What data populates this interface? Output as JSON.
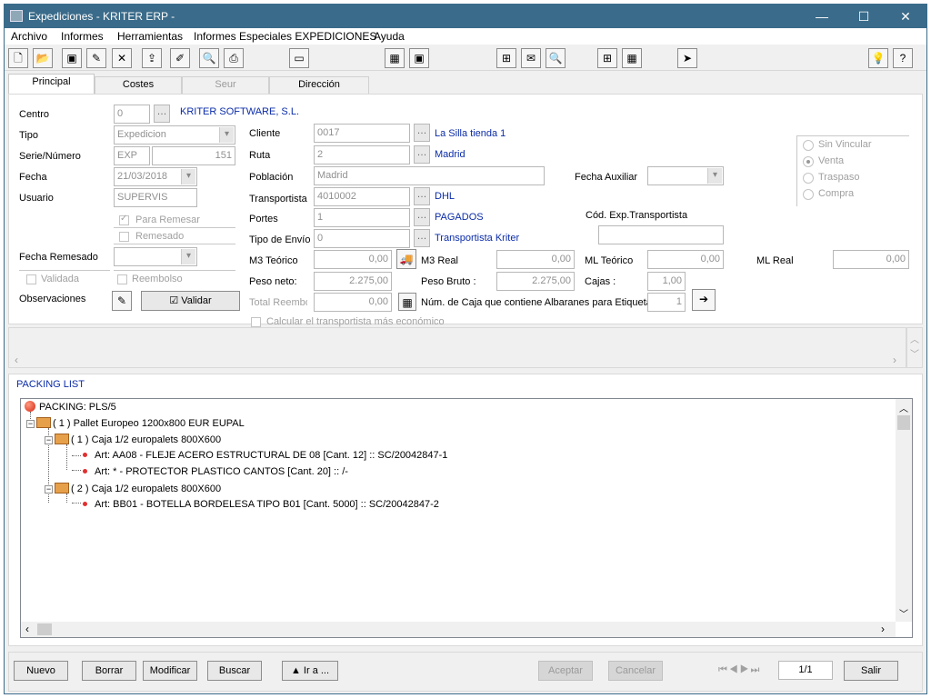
{
  "window": {
    "title": "Expediciones - KRITER ERP -"
  },
  "menu": [
    "Archivo",
    "Informes",
    "Herramientas",
    "Informes Especiales EXPEDICIONES",
    "Ayuda"
  ],
  "tabs": [
    "Principal",
    "Costes",
    "Seur",
    "Dirección"
  ],
  "form": {
    "centro_label": "Centro",
    "centro_value": "0",
    "company": "KRITER SOFTWARE, S.L.",
    "tipo_label": "Tipo",
    "tipo_value": "Expedicion",
    "serie_label": "Serie/Número",
    "serie_value": "EXP",
    "numero_value": "151",
    "fecha_label": "Fecha",
    "fecha_value": "21/03/2018",
    "usuario_label": "Usuario",
    "usuario_value": "SUPERVIS",
    "para_remesar": "Para Remesar",
    "remesado": "Remesado",
    "fecha_remesado_label": "Fecha Remesado",
    "validada": "Validada",
    "reembolso": "Reembolso",
    "observaciones": "Observaciones",
    "validar": "Validar",
    "cliente_label": "Cliente",
    "cliente_value": "0017",
    "cliente_name": "La Silla tienda 1",
    "ruta_label": "Ruta",
    "ruta_value": "2",
    "ruta_name": "Madrid",
    "poblacion_label": "Población",
    "poblacion_value": "Madrid",
    "transportista_label": "Transportista",
    "transportista_value": "4010002",
    "transportista_name": "DHL",
    "portes_label": "Portes",
    "portes_value": "1",
    "portes_name": "PAGADOS",
    "tipo_envio_label": "Tipo de Envío",
    "tipo_envio_value": "0",
    "tipo_envio_name": "Transportista Kriter",
    "fecha_aux_label": "Fecha Auxiliar",
    "cod_exp_label": "Cód. Exp.Transportista",
    "m3_teorico_label": "M3 Teórico",
    "m3_teorico_value": "0,00",
    "m3_real_label": "M3 Real",
    "m3_real_value": "0,00",
    "ml_teorico_label": "ML Teórico",
    "ml_teorico_value": "0,00",
    "ml_real_label": "ML Real",
    "ml_real_value": "0,00",
    "peso_neto_label": "Peso neto:",
    "peso_neto_value": "2.275,00",
    "peso_bruto_label": "Peso Bruto :",
    "peso_bruto_value": "2.275,00",
    "cajas_label": "Cajas :",
    "cajas_value": "1,00",
    "total_reembolso_label": "Total Reembo",
    "total_reembolso_value": "0,00",
    "num_caja_label": "Núm. de Caja que contiene Albaranes para Etiquetas",
    "num_caja_value": "1",
    "calcular_label": "Calcular el transportista más económico",
    "radio_options": [
      "Sin Vincular",
      "Venta",
      "Traspaso",
      "Compra"
    ]
  },
  "packing": {
    "title": "PACKING LIST",
    "root": "PACKING: PLS/5",
    "pallet": "( 1 ) Pallet Europeo 1200x800 EUR EUPAL",
    "caja1": "( 1 ) Caja 1/2 europalets 800X600",
    "art1": "Art: AA08 - FLEJE ACERO ESTRUCTURAL DE 08 [Cant. 12] :: SC/20042847-1",
    "art2": "Art: * - PROTECTOR PLASTICO CANTOS [Cant. 20] :: /-",
    "caja2": "( 2 ) Caja 1/2 europalets 800X600",
    "art3": "Art: BB01 - BOTELLA BORDELESA TIPO B01 [Cant. 5000] :: SC/20042847-2"
  },
  "bottom": {
    "nuevo": "Nuevo",
    "borrar": "Borrar",
    "modificar": "Modificar",
    "buscar": "Buscar",
    "ira": "▲ Ir a ...",
    "aceptar": "Aceptar",
    "cancelar": "Cancelar",
    "record": "1/1",
    "salir": "Salir"
  }
}
